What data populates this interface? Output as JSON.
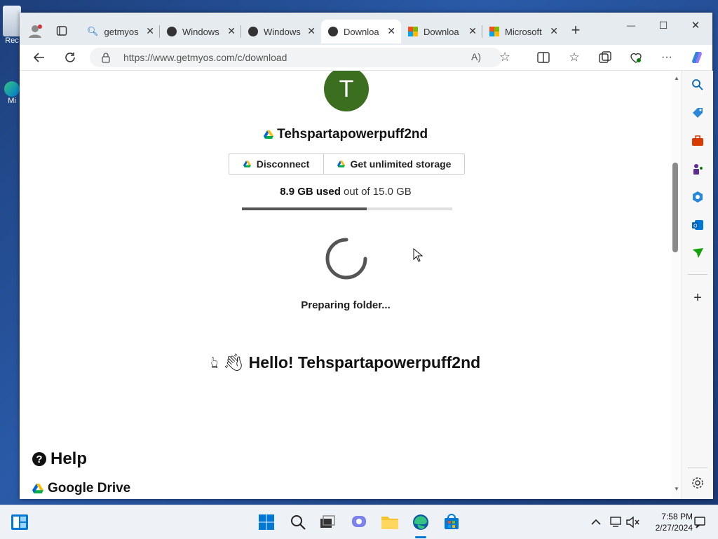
{
  "desktop": {
    "icons": [
      {
        "label": "Rec"
      },
      {
        "label": "Mi"
      }
    ]
  },
  "tabs": [
    {
      "label": "getmyos"
    },
    {
      "label": "Windows"
    },
    {
      "label": "Windows"
    },
    {
      "label": "Downloa"
    },
    {
      "label": "Downloa"
    },
    {
      "label": "Microsoft"
    }
  ],
  "tab_close_glyph": "✕",
  "new_tab_glyph": "+",
  "window_controls": {
    "minimize": "—",
    "maximize": "☐",
    "close": "✕"
  },
  "address": {
    "url": "https://www.getmyos.com/c/download"
  },
  "profile": {
    "initial": "T",
    "avatar_color": "#3b6e1f",
    "name": "Tehspartapowerpuff2nd"
  },
  "buttons": {
    "disconnect": "Disconnect",
    "unlimited": "Get unlimited storage"
  },
  "storage": {
    "used": "8.9 GB used",
    "total_text": " out of 15.0 GB",
    "fraction": 0.593
  },
  "status": {
    "preparing": "Preparing folder..."
  },
  "greeting": {
    "text": "Hello! Tehspartapowerpuff2nd"
  },
  "help": {
    "title": "Help",
    "drive": "Google Drive"
  },
  "clock": {
    "time": "7:58 PM",
    "date": "2/27/2024"
  },
  "colors": {
    "accent": "#0067c0",
    "edge_blue": "#0078d4"
  }
}
